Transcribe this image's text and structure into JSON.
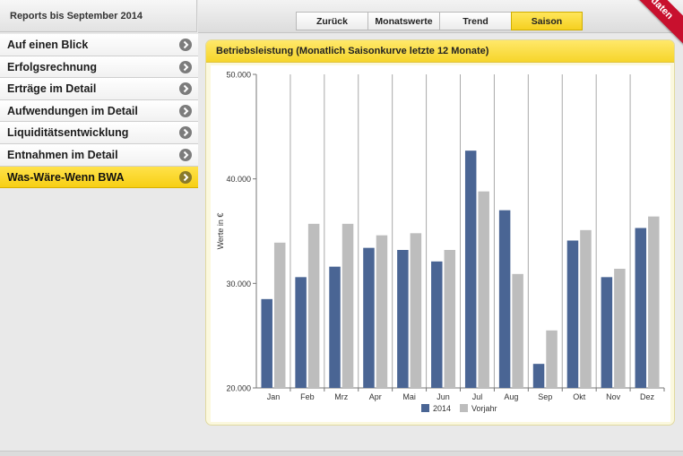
{
  "left_header": {
    "title": "Reports bis September 2014"
  },
  "sidebar": {
    "items": [
      {
        "label": "Auf einen Blick"
      },
      {
        "label": "Erfolgsrechnung"
      },
      {
        "label": "Erträge im Detail"
      },
      {
        "label": "Aufwendungen im Detail"
      },
      {
        "label": "Liquiditätsentwicklung"
      },
      {
        "label": "Entnahmen im Detail"
      },
      {
        "label": "Was-Wäre-Wenn BWA"
      }
    ],
    "active_index": 6
  },
  "toolbar": {
    "tabs": [
      {
        "label": "Zurück"
      },
      {
        "label": "Monatswerte"
      },
      {
        "label": "Trend"
      },
      {
        "label": "Saison"
      }
    ],
    "active_tab": "Saison",
    "ribbon_label": "pdaten"
  },
  "panel": {
    "title": "Betriebsleistung (Monatlich Saisonkurve letzte 12 Monate)"
  },
  "colors": {
    "accent": "#f7d22a",
    "series_2014": "#4a6594",
    "series_vorjahr": "#bdbdbd",
    "ribbon": "#c8102e"
  },
  "chart_data": {
    "type": "bar",
    "categories": [
      "Jan",
      "Feb",
      "Mrz",
      "Apr",
      "Mai",
      "Jun",
      "Jul",
      "Aug",
      "Sep",
      "Okt",
      "Nov",
      "Dez"
    ],
    "series": [
      {
        "name": "2014",
        "values": [
          28500,
          30600,
          31600,
          33400,
          33200,
          32100,
          42700,
          37000,
          22300,
          34100,
          30600,
          35300
        ]
      },
      {
        "name": "Vorjahr",
        "values": [
          33900,
          35700,
          35700,
          34600,
          34800,
          33200,
          38800,
          30900,
          25500,
          35100,
          31400,
          36400
        ]
      }
    ],
    "ylabel": "Werte in €",
    "ylim": [
      20000,
      50000
    ],
    "yticks": [
      20000,
      30000,
      40000,
      50000
    ],
    "ytick_labels": [
      "20.000",
      "30.000",
      "40.000",
      "50.000"
    ],
    "legend_position": "bottom",
    "grid": "vertical-category-lines"
  }
}
